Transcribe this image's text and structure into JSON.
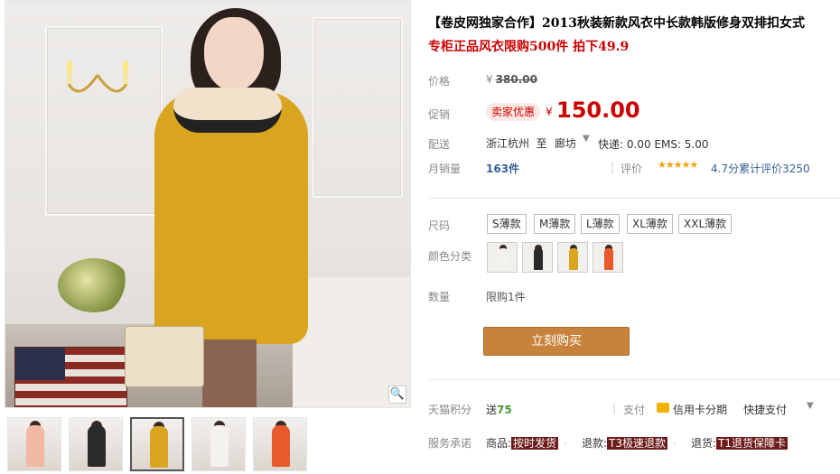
{
  "product": {
    "title": "【卷皮网独家合作】2013秋装新款风衣中长款韩版修身双排扣女式",
    "subtitle": "专柜正品风衣限购500件 拍下49.9"
  },
  "price": {
    "label": "价格",
    "yen": "¥",
    "original": "380.00"
  },
  "promo": {
    "label": "促销",
    "badge": "卖家优惠",
    "yen": "¥",
    "price": "150.00"
  },
  "shipping": {
    "label": "配送",
    "from": "浙江杭州",
    "to_word": "至",
    "to": "廊坊",
    "caret": "▼",
    "fee": "快递: 0.00 EMS: 5.00"
  },
  "sales": {
    "label": "月销量",
    "count": "163件",
    "divider": "|",
    "rate_label": "评价",
    "stars": "★★★★★",
    "rating_text": "4.7分累计评价3250"
  },
  "size": {
    "label": "尺码",
    "options": [
      "S薄款",
      "M薄款",
      "L薄款",
      "XL薄款",
      "XXL薄款"
    ]
  },
  "color": {
    "label": "颜色分类",
    "options": [
      {
        "name": "white-coat-swatch",
        "color": "#f4f2ee"
      },
      {
        "name": "black-coat-swatch",
        "color": "#2a2a2a"
      },
      {
        "name": "yellow-coat-swatch",
        "color": "#d9a51f"
      },
      {
        "name": "orange-coat-swatch",
        "color": "#e85a2c"
      }
    ]
  },
  "quantity": {
    "label": "数量",
    "limit": "限购1件"
  },
  "buy_button": "立刻购买",
  "points": {
    "label": "天猫积分",
    "prefix": "送",
    "value": "75"
  },
  "payment": {
    "divider": "|",
    "label": "支付",
    "card": "信用卡分期",
    "quick": "快捷支付",
    "caret": "▼"
  },
  "service": {
    "label": "服务承诺",
    "items": [
      {
        "prefix": "商品:",
        "tag": "按时发货"
      },
      {
        "prefix": "退款:",
        "tag": "T3极速退款"
      },
      {
        "prefix": "退货:",
        "tag": "T1退货保障卡"
      }
    ]
  },
  "gallery": {
    "zoom_icon": "🔍",
    "thumbnails": [
      {
        "coat": "#f2b8a6"
      },
      {
        "coat": "#2a2a2a"
      },
      {
        "coat": "#d9a51f"
      },
      {
        "coat": "#f4f2ee"
      },
      {
        "coat": "#e85a2c"
      }
    ],
    "active_index": 2
  },
  "colors": {
    "price_red": "#cc0000",
    "buy_button": "#c7833b",
    "link_blue": "#356096",
    "star_orange": "#f2a20f",
    "service_tag": "#6d1a1a"
  }
}
